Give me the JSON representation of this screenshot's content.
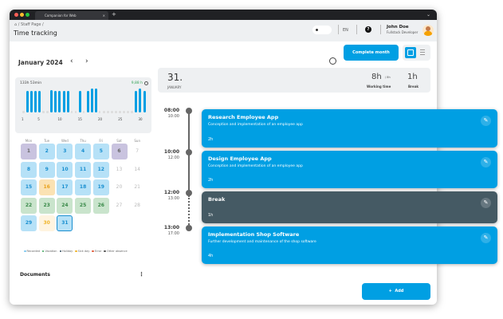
{
  "browser": {
    "tab_title": "Companion for Web",
    "close": "×",
    "new_tab": "+",
    "menu": "⌄"
  },
  "header": {
    "breadcrumb": "/ Staff Page /",
    "title": "Time tracking",
    "lang": "EN",
    "help": "?",
    "user_name": "John Doe",
    "user_role": "Fullstack Developer"
  },
  "month": {
    "label": "January 2024",
    "prev": "‹",
    "next": "›"
  },
  "summary": {
    "total": "133h 53min",
    "avg": "9,88 h",
    "ticks": [
      "1",
      "5",
      "10",
      "15",
      "20",
      "25",
      "30"
    ]
  },
  "chart_data": {
    "type": "bar",
    "x": [
      1,
      2,
      3,
      4,
      5,
      6,
      7,
      8,
      9,
      10,
      11,
      12,
      13,
      14,
      15,
      16,
      17,
      18,
      19,
      20,
      21,
      22,
      23,
      24,
      25,
      26,
      27,
      28,
      29,
      30,
      31
    ],
    "values": [
      0,
      8,
      8,
      8,
      8,
      0,
      0,
      8.5,
      8,
      8,
      8,
      8,
      0,
      0,
      8,
      0,
      8,
      9,
      9,
      0,
      0,
      0,
      0,
      0,
      0,
      0,
      0,
      0,
      8,
      9,
      8
    ],
    "xticks": [
      1,
      5,
      10,
      15,
      20,
      25,
      30
    ]
  },
  "calendar": {
    "weekdays": [
      "Mon",
      "Tue",
      "Wed",
      "Thu",
      "Fri",
      "Sat",
      "Sun"
    ],
    "days": [
      {
        "d": "1",
        "s": "holiday"
      },
      {
        "d": "2",
        "s": "recorded"
      },
      {
        "d": "3",
        "s": "recorded"
      },
      {
        "d": "4",
        "s": "recorded"
      },
      {
        "d": "5",
        "s": "recorded"
      },
      {
        "d": "6",
        "s": "holiday"
      },
      {
        "d": "7",
        "s": "none"
      },
      {
        "d": "8",
        "s": "recorded"
      },
      {
        "d": "9",
        "s": "recorded"
      },
      {
        "d": "10",
        "s": "recorded"
      },
      {
        "d": "11",
        "s": "recorded"
      },
      {
        "d": "12",
        "s": "recorded"
      },
      {
        "d": "13",
        "s": "none"
      },
      {
        "d": "14",
        "s": "none"
      },
      {
        "d": "15",
        "s": "recorded"
      },
      {
        "d": "16",
        "s": "sick"
      },
      {
        "d": "17",
        "s": "recorded"
      },
      {
        "d": "18",
        "s": "recorded"
      },
      {
        "d": "19",
        "s": "recorded"
      },
      {
        "d": "20",
        "s": "none"
      },
      {
        "d": "21",
        "s": "none"
      },
      {
        "d": "22",
        "s": "vacation"
      },
      {
        "d": "23",
        "s": "vacation"
      },
      {
        "d": "24",
        "s": "vacation"
      },
      {
        "d": "25",
        "s": "vacation"
      },
      {
        "d": "26",
        "s": "vacation"
      },
      {
        "d": "27",
        "s": "none"
      },
      {
        "d": "28",
        "s": "none"
      },
      {
        "d": "29",
        "s": "recorded"
      },
      {
        "d": "30",
        "s": "sicklight"
      },
      {
        "d": "31",
        "s": "selected"
      }
    ],
    "legend": [
      {
        "label": "Recorded",
        "color": "#7ec8ef"
      },
      {
        "label": "Vacation",
        "color": "#3aa55a"
      },
      {
        "label": "Holiday",
        "color": "#2f4a5c"
      },
      {
        "label": "Sick day",
        "color": "#f0b429"
      },
      {
        "label": "Error",
        "color": "#e05a3a"
      },
      {
        "label": "Other absence",
        "color": "#555555"
      }
    ]
  },
  "documents": {
    "title": "Documents",
    "menu": "⋮"
  },
  "day": {
    "date": "31.",
    "month": "JANUARY",
    "working": "8h",
    "target": "/ 8h",
    "working_label": "Working time",
    "break": "1h",
    "break_label": "Break"
  },
  "actions": {
    "complete": "Complete month",
    "add": "Add"
  },
  "entries": [
    {
      "start": "08:00",
      "end": "10:00",
      "title": "Research Employee App",
      "desc": "Conception and implementation of an employee app",
      "dur": "2h"
    },
    {
      "start": "10:00",
      "end": "12:00",
      "title": "Design Employee App",
      "desc": "Conception and implementation of an employee app",
      "dur": "2h"
    },
    {
      "start": "12:00",
      "end": "13:00",
      "title": "Break",
      "desc": "",
      "dur": "1h"
    },
    {
      "start": "13:00",
      "end": "17:00",
      "title": "Implementation Shop Software",
      "desc": "Further development and maintenance of the shop software",
      "dur": "4h"
    }
  ],
  "colors": {
    "accent": "#009fe3",
    "break": "#455a64"
  }
}
